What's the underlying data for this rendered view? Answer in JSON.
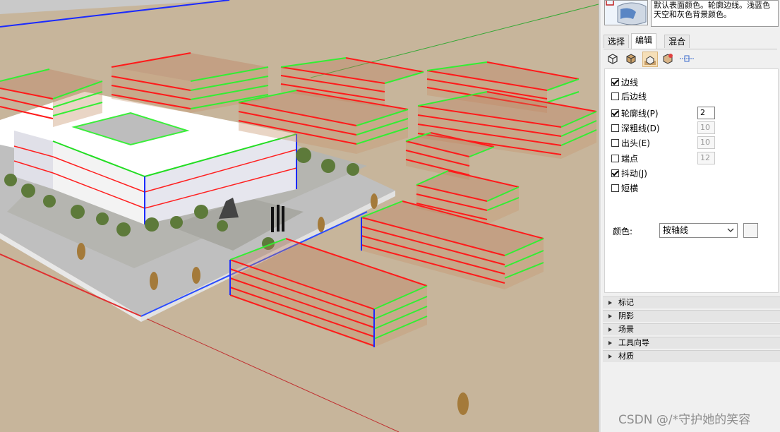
{
  "panel": {
    "style_description": "默认表面颜色。轮廓边线。浅蓝色天空和灰色背景颜色。",
    "tabs": [
      {
        "label": "选择",
        "active": false
      },
      {
        "label": "编辑",
        "active": true
      },
      {
        "label": "混合",
        "active": false
      }
    ],
    "edge_tools": [
      {
        "icon": "edge-settings-icon",
        "selected": false
      },
      {
        "icon": "face-settings-icon",
        "selected": false
      },
      {
        "icon": "background-settings-icon",
        "selected": true
      },
      {
        "icon": "watermark-settings-icon",
        "selected": false
      },
      {
        "icon": "modeling-settings-icon",
        "selected": false
      }
    ],
    "options": {
      "edges": {
        "label": "边线",
        "checked": true
      },
      "back_edges": {
        "label": "后边线",
        "checked": false
      },
      "profiles": {
        "label": "轮廓线(P)",
        "checked": true,
        "value": "2"
      },
      "depth_cue": {
        "label": "深粗线(D)",
        "checked": false,
        "value": "10"
      },
      "extension": {
        "label": "出头(E)",
        "checked": false,
        "value": "10"
      },
      "endpoints": {
        "label": "端点",
        "checked": false,
        "value": "12"
      },
      "jitter": {
        "label": "抖动(J)",
        "checked": true
      },
      "dashes": {
        "label": "短横",
        "checked": false
      }
    },
    "color": {
      "label": "颜色:",
      "selected": "按轴线"
    },
    "sections": [
      "标记",
      "阴影",
      "场景",
      "工具向导",
      "材质"
    ]
  },
  "watermark": "CSDN @/*守护她的笑容",
  "colors": {
    "ground": "#c7b59b",
    "edge_red": "#ff1a1a",
    "edge_green": "#33ee33",
    "axis_blue": "#1030ff",
    "panel_bg": "#f0f0f0"
  }
}
